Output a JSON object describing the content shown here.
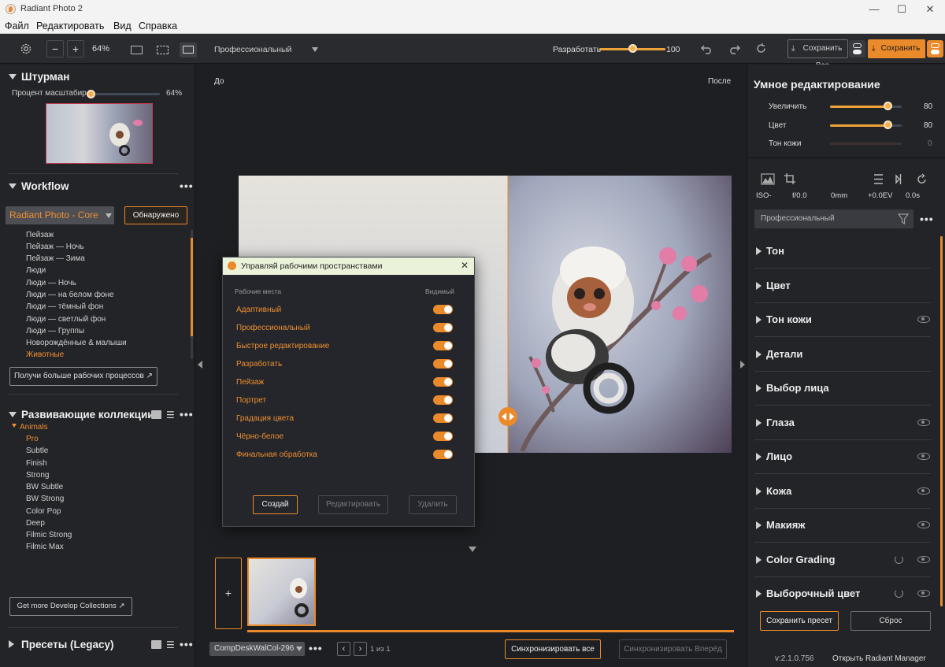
{
  "window": {
    "title": "Radiant Photo 2",
    "minimize": "—",
    "maximize": "☐",
    "close": "✕"
  },
  "menu": [
    "Файл",
    "Редактировать",
    "Вид",
    "Справка"
  ],
  "toolbar": {
    "zoom": "64%",
    "zoom_minus": "−",
    "zoom_plus": "+",
    "workspace": "Профессиональный",
    "develop_label": "Разработать",
    "develop_value": "100",
    "develop_level": 1.0,
    "save_all": "Сохранить Все",
    "save": "Сохранить"
  },
  "navigator": {
    "title": "Штурман",
    "scale_label": "Процент масштабир",
    "scale_value": "64%"
  },
  "workflow": {
    "title": "Workflow",
    "select": "Radiant Photo - Core",
    "detected": "Обнаружено",
    "items": [
      "Пейзаж",
      "Пейзаж — Ночь",
      "Пейзаж — Зима",
      "Люди",
      "Люди — Ночь",
      "Люди — на белом фоне",
      "Люди — тёмный фон",
      "Люди — светлый фон",
      "Люди — Группы",
      "Новорождённые & малыши",
      "Животные"
    ],
    "more": "Получи больше рабочих процессов"
  },
  "collections": {
    "title": "Развивающие коллекции",
    "group": "Animals",
    "items": [
      "Pro",
      "Subtle",
      "Finish",
      "Strong",
      "BW Subtle",
      "BW Strong",
      "Color Pop",
      "Deep",
      "Filmic Strong",
      "Filmic Max"
    ],
    "more": "Get more Develop Collections"
  },
  "presets": {
    "title": "Пресеты (Legacy)"
  },
  "view": {
    "before": "До",
    "after": "После"
  },
  "dialog": {
    "title": "Управляй рабочими пространствами",
    "col_workspaces": "Рабочие места",
    "col_visible": "Видимый",
    "items": [
      "Адаптивный",
      "Профессиональный",
      "Быстрое редактирование",
      "Разработать",
      "Пейзаж",
      "Портрет",
      "Градация цвета",
      "Чёрно-белое",
      "Финальная обработка"
    ],
    "create": "Создай",
    "edit": "Редактировать",
    "delete": "Удалить"
  },
  "filmstrip": {
    "add": "+",
    "file": "CompDeskWalCol-296",
    "page": "1 из 1",
    "sync_all": "Синхронизировать все",
    "sync_forward": "Синхронизировать Вперёд"
  },
  "smart": {
    "title": "Умное редактирование",
    "sliders": [
      {
        "label": "Увеличить",
        "value": "80",
        "level": 0.8
      },
      {
        "label": "Цвет",
        "value": "80",
        "level": 0.8
      },
      {
        "label": "Тон кожи",
        "value": "0",
        "level": 0.0
      }
    ]
  },
  "exif": {
    "iso": "ISO-",
    "aperture": "f/0.0",
    "focal": "0mm",
    "ev": "+0.0EV",
    "shutter": "0.0s"
  },
  "right_workspace": "Профессиональный",
  "accordion": [
    "Тон",
    "Цвет",
    "Тон кожи",
    "Детали",
    "Выбор лица",
    "Глаза",
    "Лицо",
    "Кожа",
    "Макияж",
    "Color Grading",
    "Выборочный цвет"
  ],
  "footer": {
    "save_preset": "Сохранить пресет",
    "reset": "Сброс",
    "version": "v:2.1.0.756",
    "open_manager": "Открыть Radiant Manager"
  }
}
